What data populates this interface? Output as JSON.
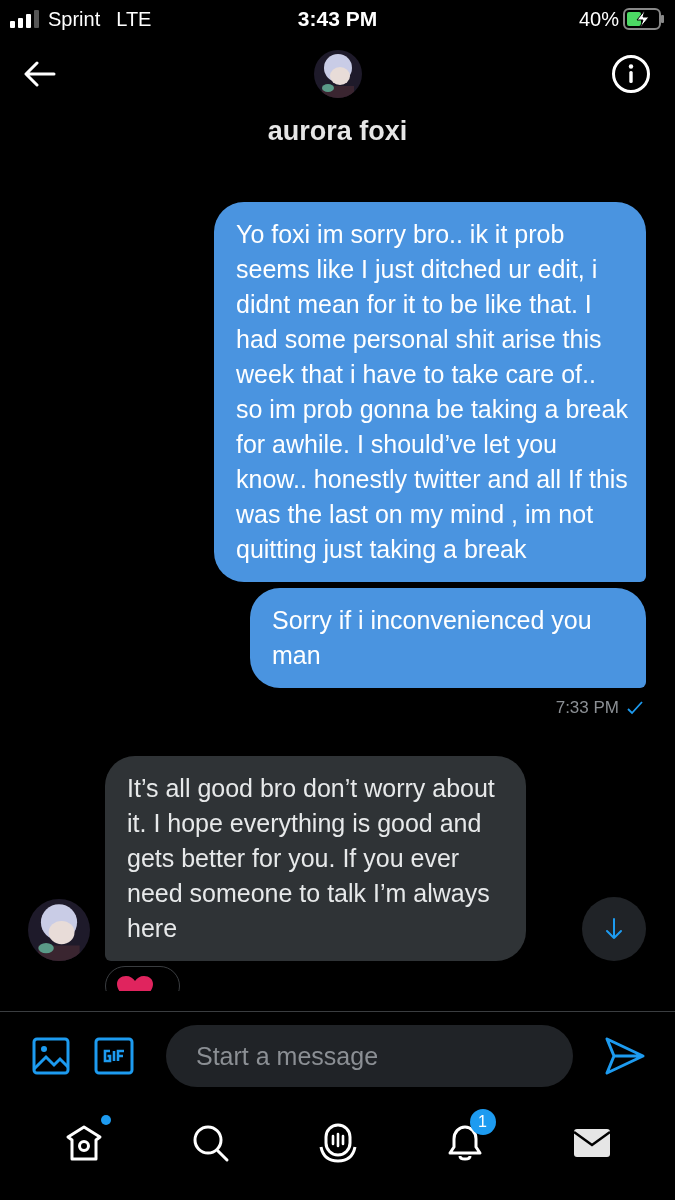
{
  "status_bar": {
    "carrier": "Sprint",
    "network": "LTE",
    "time": "3:43 PM",
    "battery": "40%",
    "charging": true
  },
  "header": {
    "title": "aurora foxi"
  },
  "messages": [
    {
      "kind": "sent",
      "text": "Yo foxi im sorry bro.. ik it prob seems like I just ditched ur edit, i didnt mean for it to be like that. I had some personal shit arise this week that i have to take care of.. so im prob gonna be taking a break for awhile. I should’ve let you know.. honestly twitter and all If this was the last on my mind , im not quitting just taking a break"
    },
    {
      "kind": "sent",
      "text": "Sorry if i inconvenienced you man",
      "time": "7:33 PM",
      "read": true
    },
    {
      "kind": "received",
      "text": "It’s all good bro don’t worry about it. I hope everything is good and gets better for you. If you ever need someone to talk I’m always here",
      "reaction": true
    }
  ],
  "composer": {
    "placeholder": "Start a message"
  },
  "nav": [
    {
      "kind": "home",
      "dot": true
    },
    {
      "kind": "search",
      "dot": false
    },
    {
      "kind": "spaces",
      "dot": false
    },
    {
      "kind": "notifications",
      "dot": false,
      "badge": "1"
    },
    {
      "kind": "messages",
      "dot": false
    }
  ]
}
